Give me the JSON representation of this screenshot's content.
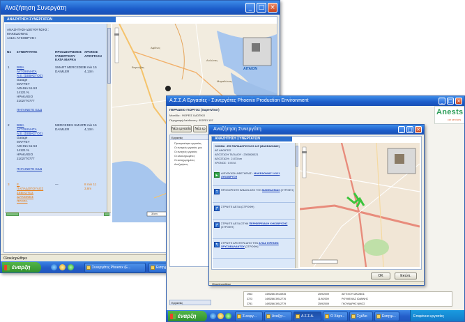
{
  "window1": {
    "title": "Αναζήτηση Συνεργάτη",
    "panel_header": "ΑΝΑΖΗΤΗΣΗ ΣΥΝΕΡΓΑΤΩΝ",
    "address_heading": "ΑΝΑΖΗΤΗΣΗ ΔΙΕΥΘΥΝΣΗΣ :",
    "address_line1": "ΜΑΚΕΔΟΝΙΑΣ",
    "address_line2": "14121 ΛΥΚΟΒΡΥΣΗ",
    "columns": [
      "Νο",
      "ΣΥΝΕΡΓΑΤΗΣ",
      "ΠΡΟΣΔΙΟΡΙΣΜΟΣ ΣΥΝΕΡΓΕΙΟΥ ΚΑΤΑ ΜΑΡΚΑ",
      "ΧΡΟΝΟΣ ΑΠΟΣΤΑΣΗ"
    ],
    "rows": [
      {
        "no": "1",
        "name_lines": [
          "ΒΙΒΑ",
          "ΑΥΤΟΚΙΝΗΤΑ",
          "Α.Ε. (ΣΕΒΑΣΤΟΣ)"
        ],
        "details": [
          "Garage",
          "MAFFEY",
          "ΑΘΗΝΑ 51-53",
          "14121 Ν.",
          "ΗΡΑΚΛΕΙΟ",
          "2102770777"
        ],
        "brand_lines": [
          "SMART MERCEDES",
          "DAIMLER"
        ],
        "time_lines": [
          "8 min 15",
          "4,13m"
        ],
        "action": "ΠΗΓΑΙΝΕΤΕ ΕΔΩ"
      },
      {
        "no": "2",
        "name_lines": [
          "ΒΙΒΑ",
          "ΑΥΤΟΚΙΝΗΤΑ",
          "Α.Ε. (ΣΕΒΑΣΤΟΣ)"
        ],
        "details": [
          "Garage",
          "MAFFEY",
          "ΑΘΗΝΑ 51-53",
          "14121 Ν.",
          "ΗΡΑΚΛΕΙΟ",
          "2102770777"
        ],
        "brand_lines": [
          "MERCEDES SMART",
          "DAIMLER"
        ],
        "time_lines": [
          "8 min 15",
          "4,13m"
        ],
        "action": "ΠΗΓΑΙΝΕΤΕ ΕΔΩ"
      },
      {
        "no": "3",
        "name_lines": [
          "Ε.",
          "ΠΑΠΑΔΟΠΟΥΛΟΣ",
          "ΣΕΒΑΣΤΟΣ",
          "ΔΙΑΝΟΜΕΣ",
          "ΠΡΟΤΑ"
        ],
        "brand_lines": [
          "—"
        ],
        "time_lines": [
          "8 min 11",
          "3,8m"
        ]
      }
    ],
    "map_place_labels": [
      "Αφίδνες",
      "Αυλώνας",
      "Καπανδρίτι",
      "Μαραθώνας",
      "Βαρνάβας"
    ],
    "brand_logo": "ΑΙΓΑΙΟΝ",
    "status_left": "Ολοκληρώθηκε",
    "scale_label": "3 km"
  },
  "window2": {
    "title": "Α.Σ.Σ.Α Εργασίες - Συνεργάτες Phoenix Production Environment",
    "logo_text": "Anests",
    "logo_sub": "car services",
    "field_label1": "ΠΕΡΑΔΕΙΟ ΓΙΩΡΓΟΣ (Supervisor)",
    "field_label2": "Μονάδα : ΦΟΡΕΙΣ ΙΔΙΩΤΙΚΟ",
    "field_label3": "Περιγραφή Διεύθυνση : ΦΟΡΕΙ 107",
    "toolbar_btn1": "Νέα εργασία",
    "toolbar_btn2": "Νέα ερ",
    "tree_header": "Εργασίες",
    "tree_items": [
      "Προτεραιότητα εργασίας",
      "Οι ανοιχτές εργασίες μου",
      "Οι ανοιχτές εργασίες",
      "Οι ολοκληρωμένες",
      "Οι καταχωρημένες",
      "Αναζητήσεις"
    ],
    "grid_rows": [
      [
        "1963",
        "1495286  394-6935",
        "25/9/2009",
        "ΑΓΓΕΛΟΥ ΙΑΚΩΒΟΣ"
      ],
      [
        "3723",
        "1495286  395-2776",
        "11/9/2009",
        "ΡΟΥΜΕΛΙΑΣ ΙΩΑΝΝΗΣ"
      ],
      [
        "2781",
        "1495286  395-2779",
        "25/9/2009",
        "ΓΚΟΥΝΑΡΗΣ ΝΙΚΟΣ"
      ]
    ],
    "status_left": "Εργασίες"
  },
  "window3": {
    "title": "Αναζήτηση Συνεργάτη",
    "panel_header": "ΑΝΑΖΗΤΗΣΗ ΣΥΝΕΡΓΑΤΩΝ",
    "summary_lines": [
      "ΟΝΟΜΑ : ΕΦ ΠΑΠΑΔΟΠΟΥΛΟΣ Α.Ε (ΜΑΚΕΔΟΝΙΑΣ)",
      "ΑΠ ΑΝΟΙΓΕΙΣ",
      "ΑΠΟΣΤΑΣΗ ΤΑΞΙΔΙΟΥ : 2300826321",
      "ΑΠΟΣΤΑΣΗ : 2.873 km",
      "ΧΡΟΝΟΣ : 8 Μ.Μ."
    ],
    "steps": [
      {
        "icon": "green",
        "text": "ΔΙΕΥΘΥΝΣΗ ΑΦΕΤΗΡΙΑΣ :",
        "link": "ΜΑΚΕΔΟΝΙΑΣ 14121 ΛΥΚΟΒΡΥΣΗ"
      },
      {
        "icon": "blue",
        "text": "ΠΡΟΧΩΡΗΣΤΕ Β/ΒΔΥΑ ΑΠΟ ΤΗΝ",
        "link": "ΜΑΚΕΔΟΝΙΑΣ",
        "after": "(ΣΤΡΟΦΗ)"
      },
      {
        "icon": "blue",
        "text": "ΣΤΡΙΨΤΕ ΔΕΞΙΑ (ΣΤΡΟΦΗ)"
      },
      {
        "icon": "blue",
        "text": "ΣΤΡΙΨΤΕ ΔΕΞΙΑ ΣΤΗΝ",
        "link": "ΠΕΡΙΦΕΡΕΙΑΚΗ ΛΥΚΟΒΡΥΣΗΣ",
        "after": "(ΣΤΡΟΦΗ)"
      },
      {
        "icon": "blue",
        "text": "ΣΤΡΙΨΤΕ ΑΡΙΣΤΕΡΑ ΑΠΟ ΤΗΝ",
        "link": "ΑΓΙΑΣ ΕΙΡΗΝΗΣ ΧΡΥΣΟΒΑΛΑΝΤΟΥ",
        "after": "(ΣΤΡΟΦΗ)"
      }
    ],
    "ok_button": "OK",
    "print_button": "Εκτύπ.",
    "status_left": "Ολοκληρώθηκε"
  },
  "taskbar_back": {
    "start": "έναρξη",
    "items": [
      "Συνεργάτες Phoenix (E...",
      "Εισηγμένες Ε..."
    ]
  },
  "taskbar_front": {
    "start": "έναρξη",
    "items": [
      "Συνεργ...",
      "Αναζητ...",
      "Α.Σ.Σ.Α.",
      "Ο Χάρτ...",
      "Σχέδιο",
      "Εισηγμ..."
    ],
    "tray_text": "Επιφάνεια εργασίας"
  },
  "colors": {
    "title_blue": "#1c5cc9",
    "panel_blue": "#cfe0f7",
    "route_green": "#3cc43c",
    "logo_green": "#2e9e5a"
  }
}
